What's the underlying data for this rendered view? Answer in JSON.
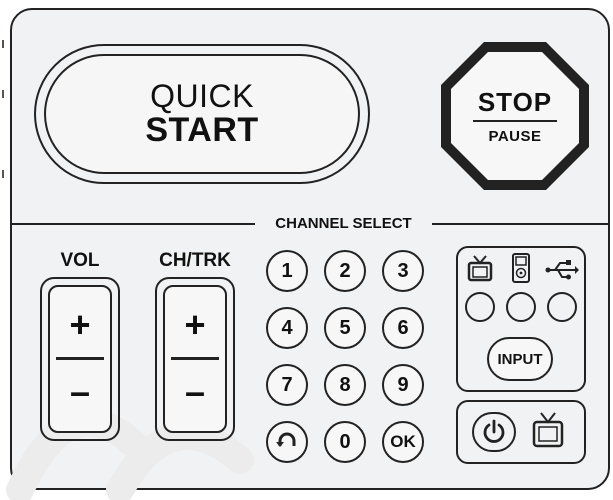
{
  "quick_start": {
    "line1": "QUICK",
    "line2": "START"
  },
  "stop": {
    "main": "STOP",
    "sub": "PAUSE"
  },
  "channel_select": {
    "label": "CHANNEL SELECT"
  },
  "volume": {
    "label": "VOL",
    "plus": "+",
    "minus": "–"
  },
  "channel_track": {
    "label": "CH/TRK",
    "plus": "+",
    "minus": "–"
  },
  "keypad": {
    "row1": [
      "1",
      "2",
      "3"
    ],
    "row2": [
      "4",
      "5",
      "6"
    ],
    "row3": [
      "7",
      "8",
      "9"
    ],
    "row4_middle": "0",
    "row4_right": "OK"
  },
  "sources": {
    "input_label": "INPUT",
    "icons": [
      "tv-icon",
      "ipod-icon",
      "usb-icon"
    ]
  },
  "power": {
    "icons": [
      "power-icon",
      "tv-icon"
    ]
  },
  "colors": {
    "ink": "#222222",
    "panel": "#f1f2f3",
    "watermark": "#e8e8e8"
  }
}
